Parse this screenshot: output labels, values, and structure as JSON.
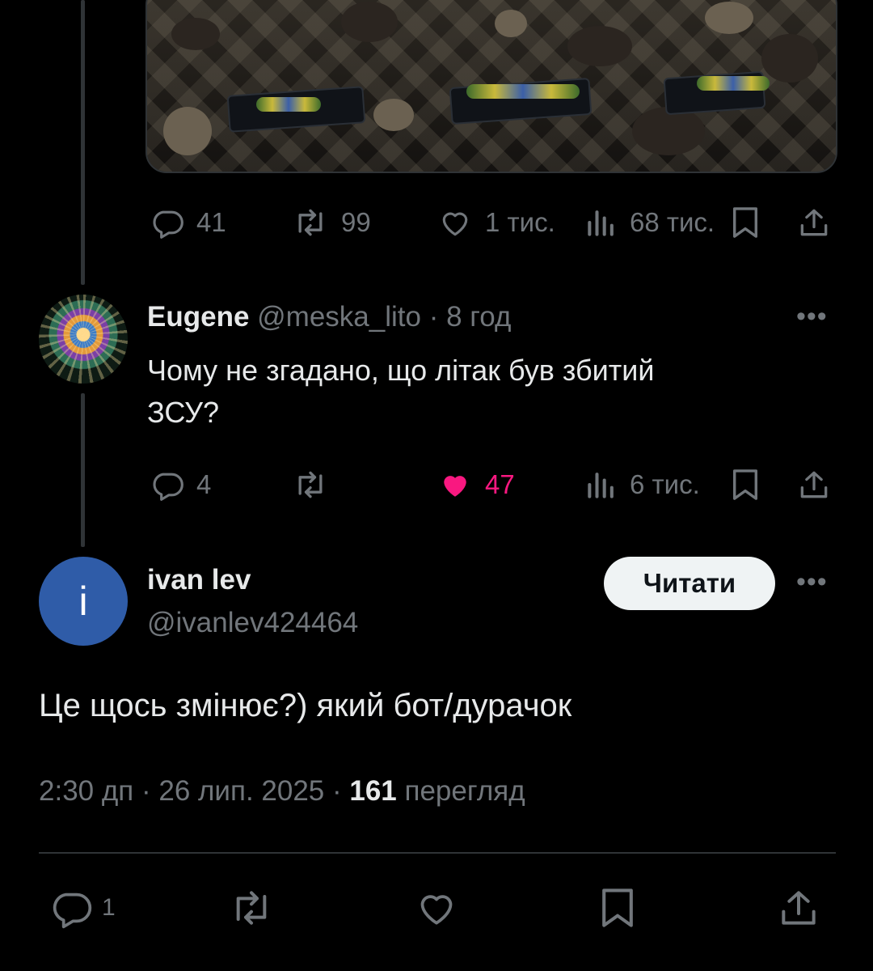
{
  "top_tweet": {
    "stats": {
      "replies": "41",
      "reposts": "99",
      "likes": "1 тис.",
      "views": "68 тис."
    }
  },
  "reply": {
    "name": "Eugene",
    "handle": "@meska_lito",
    "separator": "·",
    "time": "8 год",
    "text_line1": "Чому не згадано, що літак був збитий",
    "text_line2": "ЗСУ?",
    "stats": {
      "replies": "4",
      "likes": "47",
      "views": "6 тис."
    }
  },
  "main": {
    "avatar_letter": "i",
    "name": "ivan lev",
    "handle": "@ivanlev424464",
    "follow_label": "Читати",
    "text": "Це щось змінює?) який бот/дурачок",
    "meta_time": "2:30 дп",
    "meta_sep1": "·",
    "meta_date": "26 лип. 2025",
    "meta_sep2": "·",
    "meta_views_count": "161",
    "meta_views_label": "перегляд",
    "stats": {
      "replies": "1"
    }
  },
  "colors": {
    "like_active": "#f91880",
    "muted": "#71767b",
    "text": "#e7e9ea",
    "background": "#000000"
  },
  "icons": [
    "reply-icon",
    "repost-icon",
    "like-icon",
    "views-icon",
    "bookmark-icon",
    "share-icon",
    "more-icon"
  ]
}
